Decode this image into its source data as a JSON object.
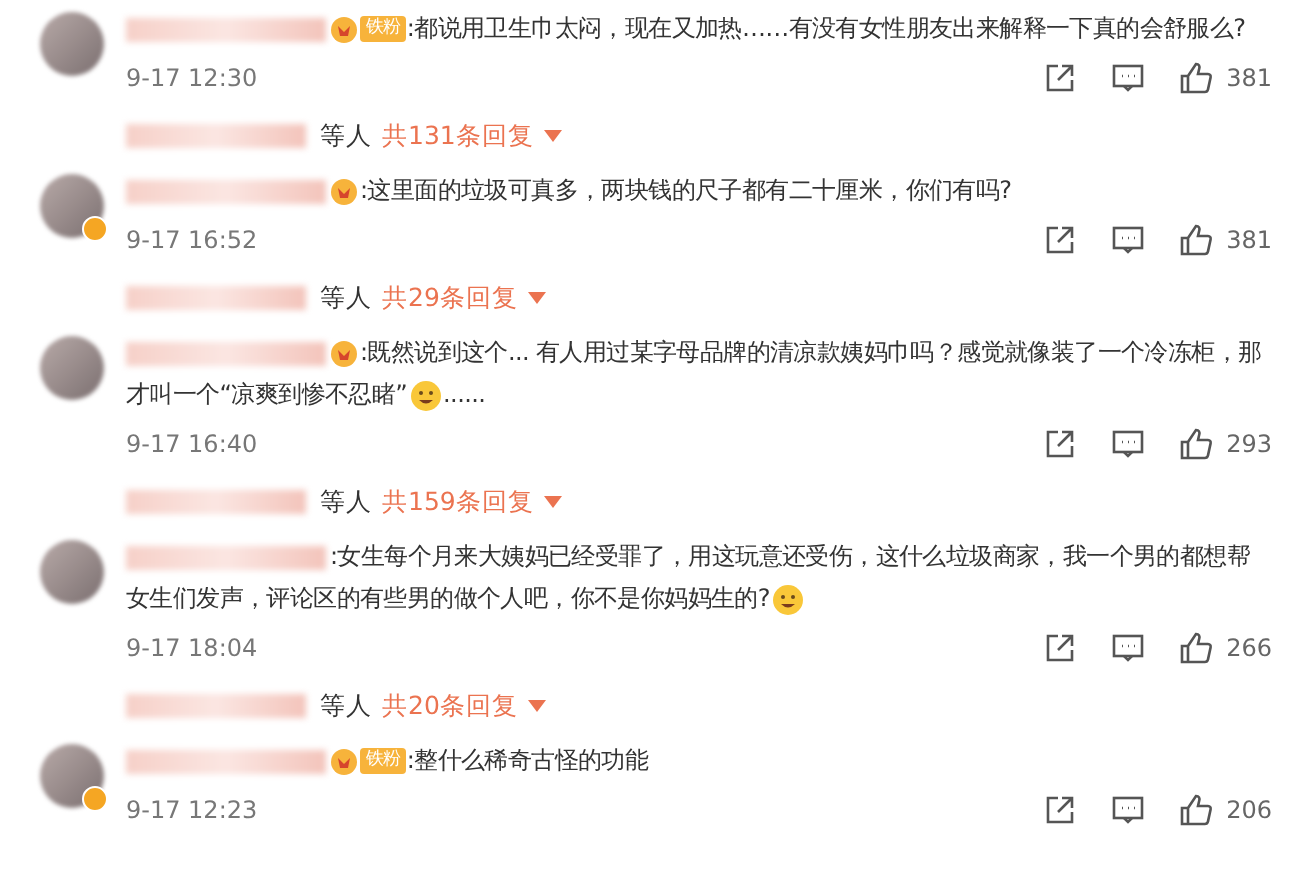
{
  "comments": [
    {
      "badge": {
        "kind": "fan",
        "label": "铁粉"
      },
      "verified": false,
      "content": [
        {
          "kind": "text",
          "text": ":都说用卫生巾太闷，现在又加热……有没有女性朋友出来解释一下真的会舒服么?"
        }
      ],
      "time": "9-17 12:30",
      "likes": "381",
      "replies": {
        "suffix": "等人",
        "count": "共131条回复"
      }
    },
    {
      "badge": {
        "kind": "emoji"
      },
      "verified": true,
      "content": [
        {
          "kind": "text",
          "text": ":这里面的垃圾可真多，两块钱的尺子都有二十厘米，你们有吗?"
        }
      ],
      "time": "9-17 16:52",
      "likes": "381",
      "replies": {
        "suffix": "等人",
        "count": "共29条回复"
      }
    },
    {
      "badge": {
        "kind": "emoji"
      },
      "verified": false,
      "content": [
        {
          "kind": "text",
          "text": ":既然说到这个... 有人用过某字母品牌的清凉款姨妈巾吗？感觉就像装了一个冷冻柜，那才叫一个“凉爽到惨不忍睹”"
        },
        {
          "kind": "emoji"
        },
        {
          "kind": "text",
          "text": "......"
        }
      ],
      "time": "9-17 16:40",
      "likes": "293",
      "replies": {
        "suffix": "等人",
        "count": "共159条回复"
      }
    },
    {
      "badge": {
        "kind": "none"
      },
      "verified": false,
      "content": [
        {
          "kind": "text",
          "text": ":女生每个月来大姨妈已经受罪了，用这玩意还受伤，这什么垃圾商家，我一个男的都想帮女生们发声，评论区的有些男的做个人吧，你不是你妈妈生的?"
        },
        {
          "kind": "emoji"
        }
      ],
      "time": "9-17 18:04",
      "likes": "266",
      "replies": {
        "suffix": "等人",
        "count": "共20条回复"
      }
    },
    {
      "badge": {
        "kind": "fan",
        "label": "铁粉"
      },
      "verified": true,
      "content": [
        {
          "kind": "text",
          "text": ":整什么稀奇古怪的功能"
        }
      ],
      "time": "9-17 12:23",
      "likes": "206"
    }
  ]
}
